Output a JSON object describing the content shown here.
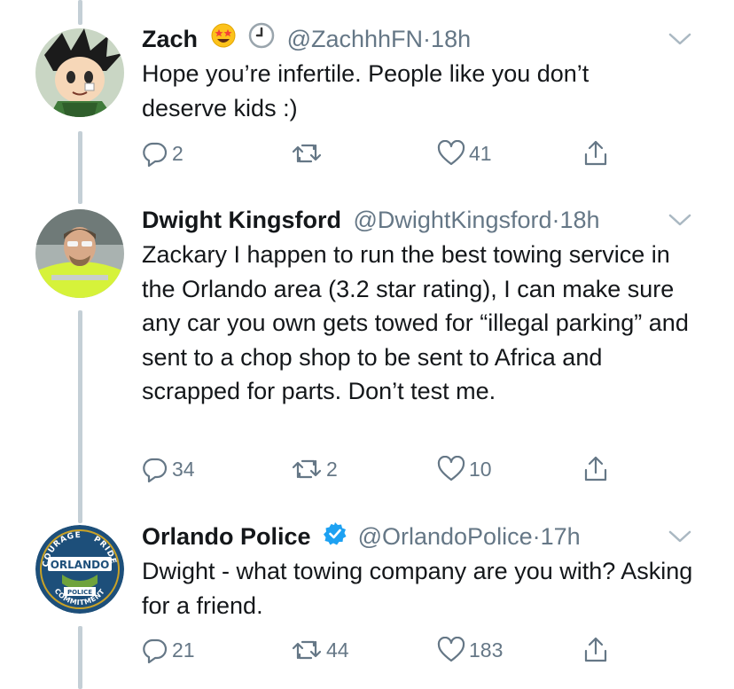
{
  "tweets": [
    {
      "name": "Zach",
      "handle": "@ZachhhFN",
      "separator": "·",
      "time": "18h",
      "text": "Hope you’re infertile. People like you don’t deserve kids :)",
      "replies": "2",
      "retweets": "",
      "likes": "41",
      "badges": [
        "star-struck-emoji-icon",
        "clock-emoji-icon"
      ]
    },
    {
      "name": "Dwight Kingsford",
      "handle": "@DwightKingsford",
      "separator": "·",
      "time": "18h",
      "text": "Zackary I happen to run the best towing service in the Orlando area (3.2 star rating), I can make sure any car you own gets towed for “illegal parking” and sent to a chop shop to be sent to Africa and scrapped for parts. Don’t test me.",
      "replies": "34",
      "retweets": "2",
      "likes": "10",
      "badges": []
    },
    {
      "name": "Orlando Police",
      "handle": "@OrlandoPolice",
      "separator": "·",
      "time": "17h",
      "text": "Dwight - what towing company are you with? Asking for a friend.",
      "replies": "21",
      "retweets": "44",
      "likes": "183",
      "badges": [
        "verified-badge-icon"
      ]
    }
  ],
  "badge_art": {
    "seal_text_top_left": "COURAGE",
    "seal_text_top_right": "PRIDE",
    "seal_text_main": "ORLANDO",
    "seal_text_banner": "POLICE",
    "seal_text_bottom": "COMMITMENT"
  },
  "colors": {
    "text": "#14171a",
    "muted": "#657786",
    "thread_line": "#c4cfd6",
    "verified": "#1da1f2"
  }
}
